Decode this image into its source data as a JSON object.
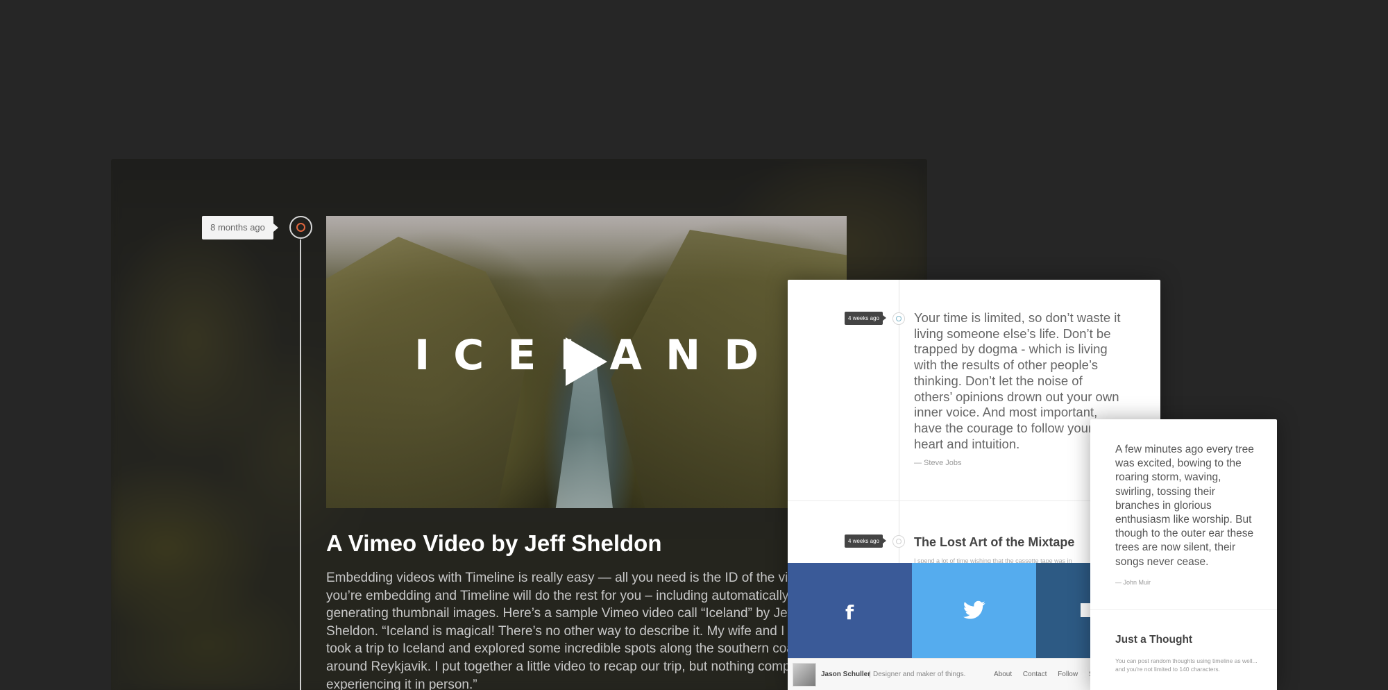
{
  "main_post": {
    "time_ago": "8 months ago",
    "video_title": "ICELAND",
    "title": "A Vimeo Video by Jeff Sheldon",
    "body": "Embedding videos with Timeline is really easy — all you need is the ID of the video you’re embedding and Timeline will do the rest for you – including automatically generating thumbnail images. Here’s a sample Vimeo video call “Iceland” by Jeff Sheldon. “Iceland is magical! There’s no other way to describe it. My wife and I recently took a trip to Iceland and explored some incredible spots along the southern coast and around Reykjavik. I put together a little video to recap our trip, but nothing compares to experiencing it in person.”"
  },
  "quote_panel": {
    "quote_time": "4 weeks ago",
    "quote": "Your time is limited, so don’t waste it living someone else’s life. Don’t be trapped by dogma - which is living with the results of other people’s thinking. Don’t let the noise of others’ opinions drown out your own inner voice. And most important, have the courage to follow your heart and intuition.",
    "quote_author": "— Steve Jobs",
    "post_time": "4 weeks ago",
    "post_title": "The Lost Art of the Mixtape",
    "post_excerpt": "I spend a lot of time wishing that the cassette tape was in",
    "social": {
      "facebook": "f",
      "twitter_icon": "twitter-bird",
      "colors": {
        "facebook": "#3a5a98",
        "twitter": "#55acee",
        "other": "#2d5a84"
      }
    },
    "footer": {
      "author_name": "Jason Schuller",
      "separator": "|",
      "author_tagline": "Designer and maker of things.",
      "nav": [
        "About",
        "Contact",
        "Follow",
        "S"
      ]
    }
  },
  "side_card": {
    "quote": "A few minutes ago every tree was excited, bowing to the roaring storm, waving, swirling, tossing their branches in glorious enthusiasm like worship. But though to the outer ear these trees are now silent, their songs never cease.",
    "quote_author": "— John Muir",
    "title": "Just a Thought",
    "text": "You can post random thoughts using timeline as well... and you're not limited to 140 characters."
  },
  "colors": {
    "background": "#262626",
    "accent_node": "#e0663e",
    "timeline_node_blue": "#7fb5c9"
  }
}
